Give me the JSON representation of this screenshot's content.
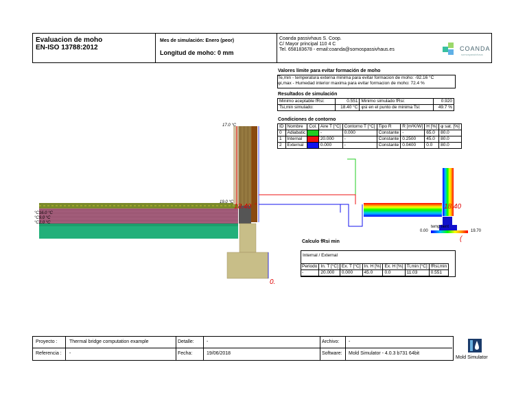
{
  "header": {
    "title_line1": "Evaluacion de moho",
    "title_line2": "EN-ISO 13788:2012",
    "month": "Mes de simulación: Enero (peor)",
    "mold_length": "Longitud de moho: 0 mm",
    "company_line1": "Coanda passivhaus S. Coop.",
    "company_line2": "C/ Mayor principal 110 4 C",
    "company_line3": "Tel. 658183678  - email:coanda@somospassivhaus.es",
    "logo_text": "COANDA",
    "logo_subtext": "somospassivhaus"
  },
  "limits": {
    "title": "Valores límite para evitar formación de moho",
    "line1": "Te,min - temperatura externa minima para evitar formacion de moho: -92.16 °C",
    "line2": "φi,max - Humedad interior maxima para evitar formacion de moho:  72.4 %"
  },
  "results": {
    "title": "Resultados de simulación",
    "rows": [
      [
        "Minimo aceptable fRsi:",
        "0.551",
        "Minimo simulado fRsi:",
        "0.920"
      ],
      [
        "Tsi,min simulado:",
        "18.40 °C",
        "φsi en el punto de minima Tsi:",
        "49.7 %"
      ]
    ]
  },
  "boundary": {
    "title": "Condiciones de contorno",
    "headers": [
      "ID",
      "Nombre",
      "Col.",
      "Aire T [°C]",
      "Contorno T [°C]",
      "Tipo R",
      "R [m²K/W]",
      "H [%]",
      "φ sat. [%]"
    ],
    "rows": [
      {
        "id": "0",
        "name": "Adiabatic",
        "color": "#22cc22",
        "air_t": "-",
        "contour_t": "0.000",
        "type": "Constante",
        "r": "-",
        "h": "65.0",
        "sat": "80.0"
      },
      {
        "id": "1",
        "name": "Internal",
        "color": "#ee1111",
        "air_t": "20.000",
        "contour_t": "-",
        "type": "Constante",
        "r": "0.2500",
        "h": "45.0",
        "sat": "80.0"
      },
      {
        "id": "2",
        "name": "External",
        "color": "#1111ee",
        "air_t": "0.000",
        "contour_t": "-",
        "type": "Constante",
        "r": "0.0400",
        "h": "0.0",
        "sat": "80.0"
      }
    ]
  },
  "calc": {
    "title": "Calculo fRsi min",
    "case": "Internal / External",
    "headers": [
      "Periodo",
      "In. T [°C]",
      "Ex. T [°C]",
      "In. H [%]",
      "Ex. H [%]",
      "Ti,min [°C]",
      "fRsi,min"
    ],
    "row": [
      "-",
      "20.000",
      "0.000",
      "45.0",
      "0.0",
      "11.03",
      "0.551"
    ]
  },
  "drawing": {
    "label_17": "17.0 °C",
    "label_19": "19.0 °C",
    "label_16": "°C16.0 °C",
    "label_9": "°C9.0 °C",
    "label_2": "°C2.0 °C",
    "temp_min_left": "18.40",
    "temp_min_right": "18.40",
    "zero_label": "0.",
    "c_label": "(",
    "legend_left": "0.00",
    "legend_right": "19.70",
    "legend_caption": "temp        lient"
  },
  "footer": {
    "project_label": "Proyecto :",
    "project_value": "Thermal bridge computation example",
    "detail_label": "Detalle:",
    "detail_value": "-",
    "archive_label": "Archivo:",
    "archive_value": "-",
    "ref_label": "Referencia :",
    "ref_value": "-",
    "date_label": "Fecha:",
    "date_value": "19/06/2018",
    "software_label": "Software:",
    "software_value": "Mold Simulator - 4.0.3 b731 64bit",
    "app_name": "Mold Simulator"
  }
}
